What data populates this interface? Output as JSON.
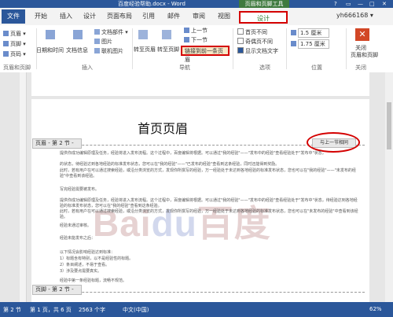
{
  "window": {
    "title": "百度经验帮助.docx - Word",
    "context_tab_title": "页眉和页脚工具",
    "controls": [
      "?",
      "▭",
      "—",
      "□",
      "✕"
    ]
  },
  "tabs": {
    "file": "文件",
    "items": [
      "开始",
      "插入",
      "设计",
      "页面布局",
      "引用",
      "邮件",
      "审阅",
      "视图"
    ],
    "design": "设计",
    "user": "yh666168 ▾"
  },
  "ribbon": {
    "header_footer_group": {
      "header": "页眉 ▾",
      "footer": "页脚 ▾",
      "page_number": "页码 ▾",
      "label": "页眉和页脚"
    },
    "insert_group": {
      "date_time": "日期和时间",
      "doc_info": "文档信息",
      "doc_parts": "文档部件 ▾",
      "picture": "图片",
      "online_picture": "联机图片",
      "label": "插入"
    },
    "nav_group": {
      "goto_header": "转至页眉",
      "goto_footer": "转至页脚",
      "prev": "上一节",
      "next": "下一节",
      "link_prev": "链接到前一条页眉",
      "label": "导航"
    },
    "options_group": {
      "diff_first": "首页不同",
      "diff_odd_even": "奇偶页不同",
      "show_text": "显示文档文字",
      "label": "选项"
    },
    "position_group": {
      "top_value": "1.5 厘米",
      "bottom_value": "1.75 厘米",
      "label": "位置"
    },
    "close_group": {
      "close": "关闭",
      "close_sub": "页眉和页脚",
      "label": "关闭"
    }
  },
  "document": {
    "header_title": "首页页眉",
    "header_label": "页眉 - 第 2 节 -",
    "same_as_prev": "与上一节相同",
    "footer_label": "页脚 - 第 2 节 -",
    "watermark_left": "Bai",
    "watermark_paw": "du",
    "watermark_right": "百度",
    "body": [
      "提供你成功编辑原理及任务，经验将进入发布流程。这个过程中，百度编辑将根据。可以通过\"我的经验\"——\"发布中的经验\"查看经验处于\"发布中\"状态，",
      "的状态，待经验达到各地经验的标准发布状态，您可以在\"我的经验\"——\"已发布的经验\"查看到这条经验，同时还能得到奖励。",
      "此时，若有用户在可以通过搜索经验，或沿分类浏览的方式，发现你所撰写的经验，万一经验处于未达到各地经验的标准发布状态，您也可以在\"我的经验\"——\"未发布的经验\"中查看到该经验。",
      "写完经验需要被发布。",
      "提供你成功编辑原理及任务，经验将进入发布流程。这个过程中，百度编辑将根据。可以通过\"我的经验\"——\"发布中的经验\"查看经验处于\"发布中\"状态，待经验达到各地经验的标准发布状态，您可以在\"我的经验\"查看到这条经验。",
      "此时，若有用户在可以通过搜索经验，或沿分类浏览的方式，发现你所撰写的经验，万一经验处于未达到各地经验的标准发布状态，您也可以在\"未发布的经验\"中查看到该经验。",
      "经验未通过审核。",
      "经验未能发布之后：",
      "以下情况会影响经验达到标准：",
      "1）标题含有特别，以不是经验性的标题。",
      "2）条目阐述，不易于查看。",
      "3）涉及要点需要真实。",
      "经验中第一条经验标题，流畅不规范。"
    ]
  },
  "status": {
    "section": "第 2 节",
    "page": "第 1 页，共 6 页",
    "words": "2563 个字",
    "lang": "中文(中国)",
    "zoom": "62%"
  }
}
